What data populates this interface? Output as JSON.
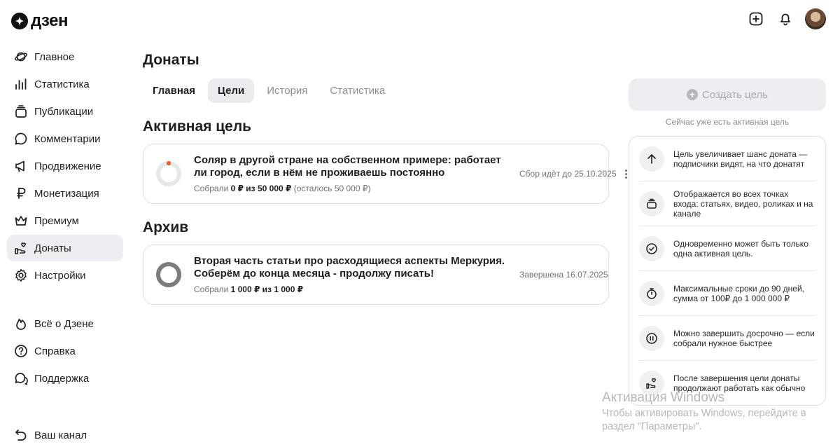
{
  "brand": {
    "name": "дзен"
  },
  "sidebar": {
    "items": [
      {
        "label": "Главное",
        "icon": "planet-icon"
      },
      {
        "label": "Статистика",
        "icon": "bar-chart-icon"
      },
      {
        "label": "Публикации",
        "icon": "stack-icon"
      },
      {
        "label": "Комментарии",
        "icon": "chat-bubble-icon"
      },
      {
        "label": "Продвижение",
        "icon": "megaphone-icon"
      },
      {
        "label": "Монетизация",
        "icon": "ruble-icon"
      },
      {
        "label": "Премиум",
        "icon": "crown-icon"
      },
      {
        "label": "Донаты",
        "icon": "donate-hand-icon"
      },
      {
        "label": "Настройки",
        "icon": "gear-icon"
      }
    ],
    "secondary": [
      {
        "label": "Всё о Дзене",
        "icon": "flame-icon"
      },
      {
        "label": "Справка",
        "icon": "help-icon"
      },
      {
        "label": "Поддержка",
        "icon": "support-chat-icon"
      }
    ],
    "bottom": {
      "label": "Ваш канал",
      "icon": "back-arrow-icon"
    }
  },
  "page": {
    "title": "Донаты",
    "tabs": [
      "Главная",
      "Цели",
      "История",
      "Статистика"
    ],
    "active_tab": "Цели"
  },
  "active_section": {
    "title": "Активная цель",
    "goal": {
      "title": "Соляр в другой стране на собственном примере: работает ли город, если в нём не проживаешь постоянно",
      "collected_label": "Собрали",
      "collected_value": "0 ₽ из 50 000 ₽",
      "remaining": "(осталось 50 000 ₽)",
      "status": "Сбор идёт до 25.10.2025",
      "progress_fraction": 0
    }
  },
  "archive_section": {
    "title": "Архив",
    "goal": {
      "title": "Вторая часть статьи про расходящиеся аспекты Меркурия. Соберём до конца месяца - продолжу писать!",
      "collected_label": "Собрали",
      "collected_value": "1 000 ₽ из 1 000 ₽",
      "status": "Завершена 16.07.2025",
      "progress_fraction": 1
    }
  },
  "create_goal": {
    "label": "Создать цель",
    "note": "Сейчас уже есть активная цель"
  },
  "info_items": [
    {
      "text": "Цель увеличивает шанс доната — подписчики видят, на что донатят",
      "icon": "arrow-up-icon"
    },
    {
      "text": "Отображается во всех точках входа: статьях, видео, роликах и на канале",
      "icon": "layers-icon"
    },
    {
      "text": "Одновременно может быть только одна активная цель.",
      "icon": "check-circle-icon"
    },
    {
      "text": "Максимальные сроки до 90 дней, сумма от 100₽ до 1 000 000 ₽",
      "icon": "stopwatch-icon"
    },
    {
      "text": "Можно завершить досрочно — если собрали нужное быстрее",
      "icon": "pause-circle-icon"
    },
    {
      "text": "После завершения цели донаты продолжают работать как обычно",
      "icon": "donate-hand-icon"
    }
  ],
  "watermark": {
    "title": "Активация Windows",
    "subtitle": "Чтобы активировать Windows, перейдите в раздел \"Параметры\"."
  },
  "colors": {
    "accent_orange": "#f15a24",
    "ring_done": "#7a7c80",
    "ring_track": "#e6e7e9"
  }
}
